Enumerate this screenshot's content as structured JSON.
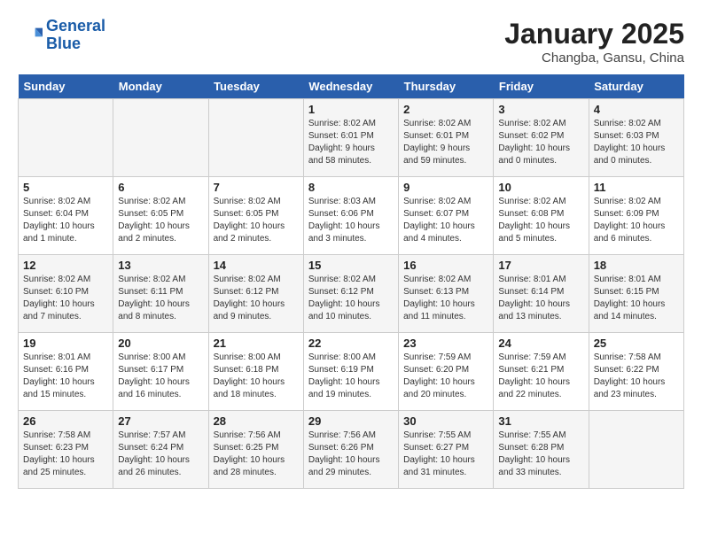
{
  "logo": {
    "line1": "General",
    "line2": "Blue"
  },
  "title": "January 2025",
  "subtitle": "Changba, Gansu, China",
  "headers": [
    "Sunday",
    "Monday",
    "Tuesday",
    "Wednesday",
    "Thursday",
    "Friday",
    "Saturday"
  ],
  "weeks": [
    [
      {
        "day": "",
        "info": ""
      },
      {
        "day": "",
        "info": ""
      },
      {
        "day": "",
        "info": ""
      },
      {
        "day": "1",
        "info": "Sunrise: 8:02 AM\nSunset: 6:01 PM\nDaylight: 9 hours\nand 58 minutes."
      },
      {
        "day": "2",
        "info": "Sunrise: 8:02 AM\nSunset: 6:01 PM\nDaylight: 9 hours\nand 59 minutes."
      },
      {
        "day": "3",
        "info": "Sunrise: 8:02 AM\nSunset: 6:02 PM\nDaylight: 10 hours\nand 0 minutes."
      },
      {
        "day": "4",
        "info": "Sunrise: 8:02 AM\nSunset: 6:03 PM\nDaylight: 10 hours\nand 0 minutes."
      }
    ],
    [
      {
        "day": "5",
        "info": "Sunrise: 8:02 AM\nSunset: 6:04 PM\nDaylight: 10 hours\nand 1 minute."
      },
      {
        "day": "6",
        "info": "Sunrise: 8:02 AM\nSunset: 6:05 PM\nDaylight: 10 hours\nand 2 minutes."
      },
      {
        "day": "7",
        "info": "Sunrise: 8:02 AM\nSunset: 6:05 PM\nDaylight: 10 hours\nand 2 minutes."
      },
      {
        "day": "8",
        "info": "Sunrise: 8:03 AM\nSunset: 6:06 PM\nDaylight: 10 hours\nand 3 minutes."
      },
      {
        "day": "9",
        "info": "Sunrise: 8:02 AM\nSunset: 6:07 PM\nDaylight: 10 hours\nand 4 minutes."
      },
      {
        "day": "10",
        "info": "Sunrise: 8:02 AM\nSunset: 6:08 PM\nDaylight: 10 hours\nand 5 minutes."
      },
      {
        "day": "11",
        "info": "Sunrise: 8:02 AM\nSunset: 6:09 PM\nDaylight: 10 hours\nand 6 minutes."
      }
    ],
    [
      {
        "day": "12",
        "info": "Sunrise: 8:02 AM\nSunset: 6:10 PM\nDaylight: 10 hours\nand 7 minutes."
      },
      {
        "day": "13",
        "info": "Sunrise: 8:02 AM\nSunset: 6:11 PM\nDaylight: 10 hours\nand 8 minutes."
      },
      {
        "day": "14",
        "info": "Sunrise: 8:02 AM\nSunset: 6:12 PM\nDaylight: 10 hours\nand 9 minutes."
      },
      {
        "day": "15",
        "info": "Sunrise: 8:02 AM\nSunset: 6:12 PM\nDaylight: 10 hours\nand 10 minutes."
      },
      {
        "day": "16",
        "info": "Sunrise: 8:02 AM\nSunset: 6:13 PM\nDaylight: 10 hours\nand 11 minutes."
      },
      {
        "day": "17",
        "info": "Sunrise: 8:01 AM\nSunset: 6:14 PM\nDaylight: 10 hours\nand 13 minutes."
      },
      {
        "day": "18",
        "info": "Sunrise: 8:01 AM\nSunset: 6:15 PM\nDaylight: 10 hours\nand 14 minutes."
      }
    ],
    [
      {
        "day": "19",
        "info": "Sunrise: 8:01 AM\nSunset: 6:16 PM\nDaylight: 10 hours\nand 15 minutes."
      },
      {
        "day": "20",
        "info": "Sunrise: 8:00 AM\nSunset: 6:17 PM\nDaylight: 10 hours\nand 16 minutes."
      },
      {
        "day": "21",
        "info": "Sunrise: 8:00 AM\nSunset: 6:18 PM\nDaylight: 10 hours\nand 18 minutes."
      },
      {
        "day": "22",
        "info": "Sunrise: 8:00 AM\nSunset: 6:19 PM\nDaylight: 10 hours\nand 19 minutes."
      },
      {
        "day": "23",
        "info": "Sunrise: 7:59 AM\nSunset: 6:20 PM\nDaylight: 10 hours\nand 20 minutes."
      },
      {
        "day": "24",
        "info": "Sunrise: 7:59 AM\nSunset: 6:21 PM\nDaylight: 10 hours\nand 22 minutes."
      },
      {
        "day": "25",
        "info": "Sunrise: 7:58 AM\nSunset: 6:22 PM\nDaylight: 10 hours\nand 23 minutes."
      }
    ],
    [
      {
        "day": "26",
        "info": "Sunrise: 7:58 AM\nSunset: 6:23 PM\nDaylight: 10 hours\nand 25 minutes."
      },
      {
        "day": "27",
        "info": "Sunrise: 7:57 AM\nSunset: 6:24 PM\nDaylight: 10 hours\nand 26 minutes."
      },
      {
        "day": "28",
        "info": "Sunrise: 7:56 AM\nSunset: 6:25 PM\nDaylight: 10 hours\nand 28 minutes."
      },
      {
        "day": "29",
        "info": "Sunrise: 7:56 AM\nSunset: 6:26 PM\nDaylight: 10 hours\nand 29 minutes."
      },
      {
        "day": "30",
        "info": "Sunrise: 7:55 AM\nSunset: 6:27 PM\nDaylight: 10 hours\nand 31 minutes."
      },
      {
        "day": "31",
        "info": "Sunrise: 7:55 AM\nSunset: 6:28 PM\nDaylight: 10 hours\nand 33 minutes."
      },
      {
        "day": "",
        "info": ""
      }
    ]
  ]
}
